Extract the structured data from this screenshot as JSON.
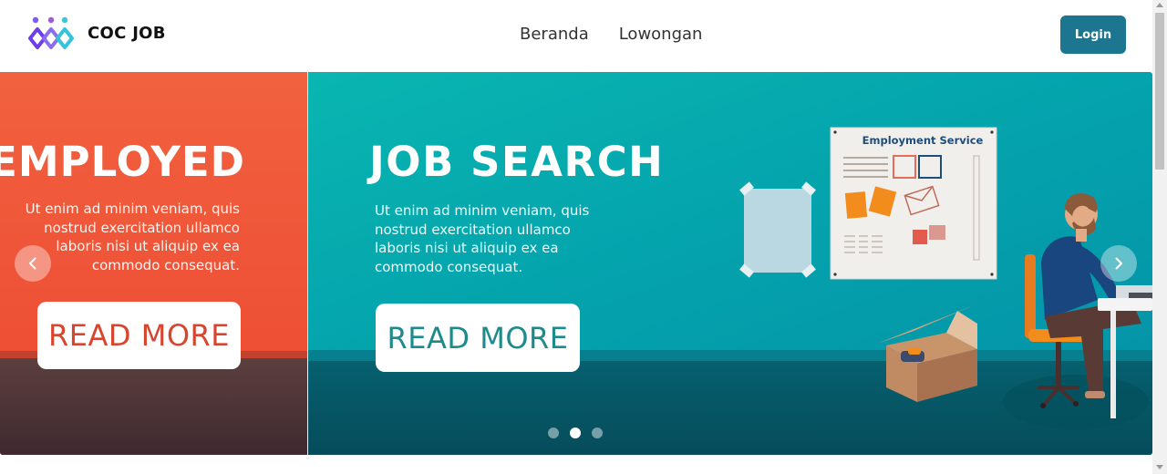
{
  "navbar": {
    "brand_name": "COC JOB",
    "logo_icon": "people-links-logo-icon",
    "links": [
      {
        "label": "Beranda"
      },
      {
        "label": "Lowongan"
      }
    ],
    "login_label": "Login",
    "login_color": "#1c7690"
  },
  "carousel": {
    "active_index": 1,
    "slide_count": 3,
    "prev_slide": {
      "title": "EMPLOYED",
      "text": "Ut enim ad minim veniam, quis nostrud exercitation ullamco laboris nisi ut aliquip ex ea commodo consequat.",
      "button_label": "READ MORE",
      "background_color": "#ee4f35"
    },
    "active_slide": {
      "title": "JOB SEARCH",
      "text": "Ut enim ad minim veniam, quis nostrud exercitation ullamco laboris nisi ut aliquip ex ea commodo consequat.",
      "button_label": "READ MORE",
      "background_color": "#04a3ad",
      "board_title": "Employment Service"
    },
    "prev_icon": "chevron-left-icon",
    "next_icon": "chevron-right-icon"
  }
}
